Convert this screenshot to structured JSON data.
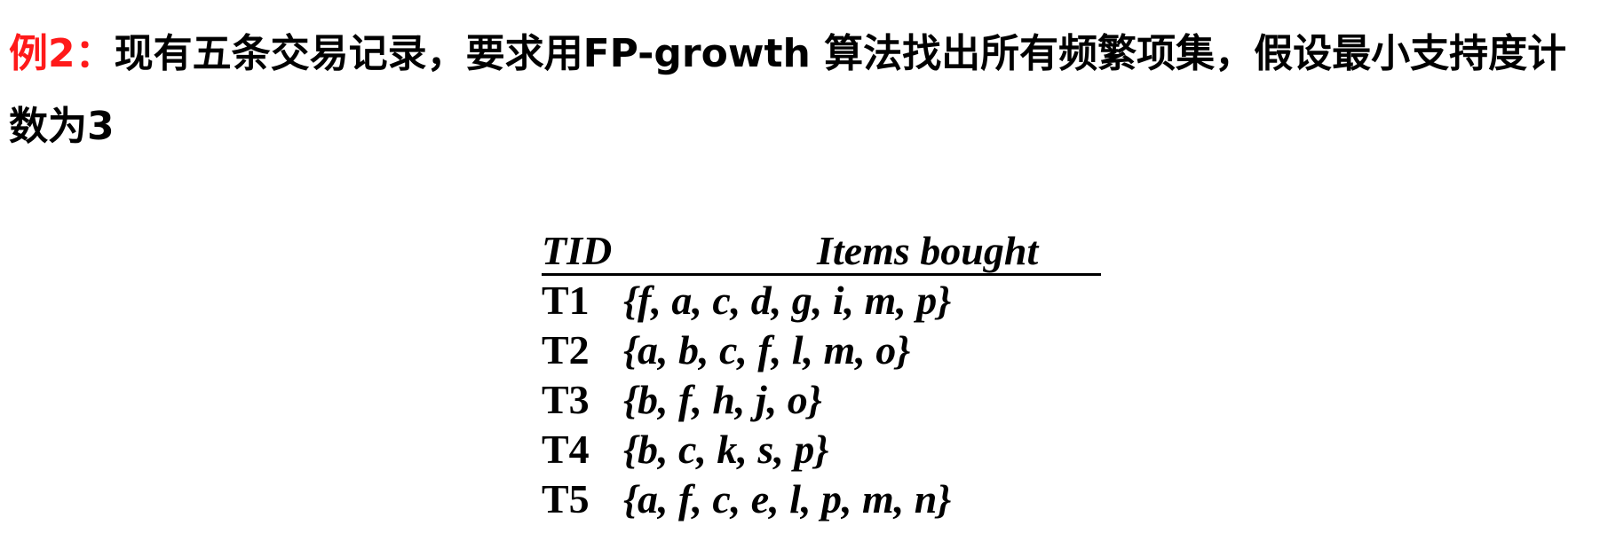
{
  "problem": {
    "label": "例2：",
    "text": "现有五条交易记录，要求用FP-growth 算法找出所有频繁项集，假设最小支持度计数为3"
  },
  "table": {
    "headers": [
      "TID",
      "Items bought"
    ],
    "rows": [
      {
        "tid": "T1",
        "items": "{f, a, c, d, g, i, m, p}"
      },
      {
        "tid": "T2",
        "items": "{a, b, c, f, l, m, o}"
      },
      {
        "tid": "T3",
        "items": "{b, f, h, j, o}"
      },
      {
        "tid": "T4",
        "items": "{b, c, k, s, p}"
      },
      {
        "tid": "T5",
        "items": "{a, f, c, e, l, p, m, n}"
      }
    ]
  },
  "colors": {
    "label": "#ff1a1a",
    "text": "#000000"
  }
}
